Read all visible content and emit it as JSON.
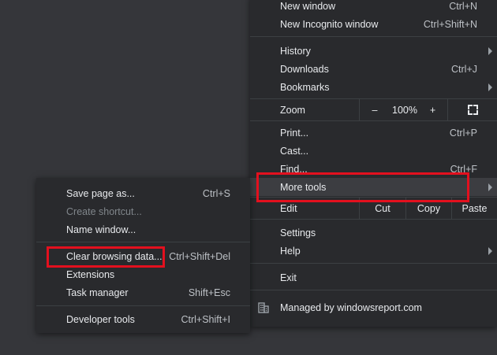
{
  "main_menu": {
    "new_window": {
      "label": "New window",
      "shortcut": "Ctrl+N"
    },
    "new_incognito": {
      "label": "New Incognito window",
      "shortcut": "Ctrl+Shift+N"
    },
    "history": {
      "label": "History"
    },
    "downloads": {
      "label": "Downloads",
      "shortcut": "Ctrl+J"
    },
    "bookmarks": {
      "label": "Bookmarks"
    },
    "zoom": {
      "label": "Zoom",
      "minus": "–",
      "level": "100%",
      "plus": "+"
    },
    "print": {
      "label": "Print...",
      "shortcut": "Ctrl+P"
    },
    "cast": {
      "label": "Cast..."
    },
    "find": {
      "label": "Find...",
      "shortcut": "Ctrl+F"
    },
    "more_tools": {
      "label": "More tools"
    },
    "edit": {
      "label": "Edit",
      "cut": "Cut",
      "copy": "Copy",
      "paste": "Paste"
    },
    "settings": {
      "label": "Settings"
    },
    "help": {
      "label": "Help"
    },
    "exit": {
      "label": "Exit"
    },
    "managed": {
      "label": "Managed by windowsreport.com"
    }
  },
  "sub_menu": {
    "save_page": {
      "label": "Save page as...",
      "shortcut": "Ctrl+S"
    },
    "create_shortcut": {
      "label": "Create shortcut..."
    },
    "name_window": {
      "label": "Name window..."
    },
    "clear_browsing": {
      "label": "Clear browsing data...",
      "shortcut": "Ctrl+Shift+Del"
    },
    "extensions": {
      "label": "Extensions"
    },
    "task_manager": {
      "label": "Task manager",
      "shortcut": "Shift+Esc"
    },
    "developer_tools": {
      "label": "Developer tools",
      "shortcut": "Ctrl+Shift+I"
    }
  },
  "colors": {
    "background": "#35363a",
    "menu": "#292a2d",
    "highlight_box": "#e3101e"
  }
}
